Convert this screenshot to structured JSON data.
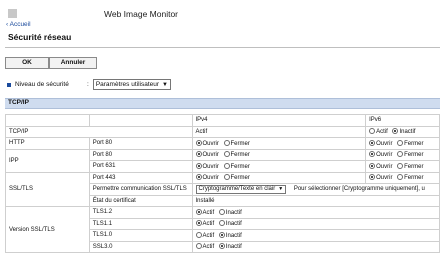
{
  "header": {
    "app_title": "Web Image Monitor"
  },
  "nav": {
    "back_label": "‹ Accueil"
  },
  "page": {
    "title": "Sécurité réseau"
  },
  "buttons": {
    "ok": "OK",
    "cancel": "Annuler"
  },
  "security_level": {
    "label": "Niveau de sécurité",
    "colon": ":",
    "selected": "Paramètres utilisateur"
  },
  "section": {
    "title": "TCP/IP"
  },
  "table": {
    "col_ipv4": "IPv4",
    "col_ipv6": "IPv6",
    "rows": {
      "tcpip": {
        "label": "TCP/IP",
        "ipv4": "Actif",
        "ipv6_opt1": "Actif",
        "ipv6_opt2": "Inactif"
      },
      "http": {
        "label": "HTTP",
        "sub": "Port 80",
        "open": "Ouvrir",
        "close": "Fermer"
      },
      "ipp_80": {
        "label": "IPP",
        "sub": "Port 80",
        "open": "Ouvrir",
        "close": "Fermer"
      },
      "ipp_631": {
        "sub": "Port 631",
        "open": "Ouvrir",
        "close": "Fermer"
      },
      "ssl_443": {
        "label": "SSL/TLS",
        "sub": "Port 443",
        "open": "Ouvrir",
        "close": "Fermer"
      },
      "ssl_comm": {
        "sub": "Permettre communication SSL/TLS",
        "select": "Cryptogramme/Texte en clair",
        "hint": "Pour sélectionner [Cryptogramme uniquement], u"
      },
      "cert": {
        "sub": "État du certificat",
        "value": "Installé"
      },
      "tls12": {
        "label": "Version SSL/TLS",
        "sub": "TLS1.2",
        "on": "Actif",
        "off": "Inactif"
      },
      "tls11": {
        "sub": "TLS1.1",
        "on": "Actif",
        "off": "Inactif"
      },
      "tls10": {
        "sub": "TLS1.0",
        "on": "Actif",
        "off": "Inactif"
      },
      "ssl30": {
        "sub": "SSL3.0",
        "on": "Actif",
        "off": "Inactif"
      }
    }
  }
}
